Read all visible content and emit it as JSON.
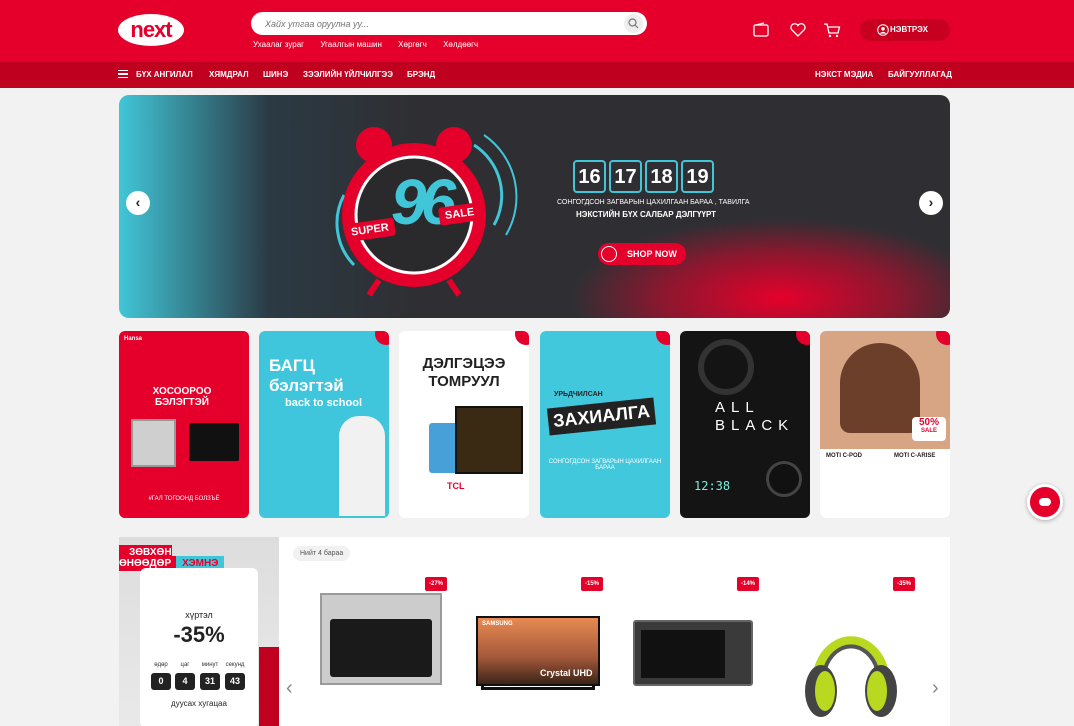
{
  "header": {
    "logo_text": "next",
    "search_placeholder": "Хайх утгаа оруулна уу...",
    "quick_links": [
      "Ухаалаг зураг",
      "Угаалгын машин",
      "Хөргөгч",
      "Хөлдөөгч"
    ],
    "login_label": "НЭВТРЭХ"
  },
  "nav": {
    "all_categories": "БҮХ АНГИЛАЛ",
    "items": [
      "ХЯМДРАЛ",
      "ШИНЭ",
      "ЗЭЭЛИЙН ҮЙЛЧИЛГЭЭ",
      "БРЭНД"
    ],
    "right_items": [
      "НЭКСТ МЭДИА",
      "БАЙГУУЛЛАГАД"
    ]
  },
  "hero": {
    "days": [
      "16",
      "17",
      "18",
      "19"
    ],
    "headline_super": "SUPER",
    "headline_number": "96",
    "headline_sale": "SALE",
    "line1": "СОНГОГДСОН ЗАГВАРЫН ЦАХИЛГААН БАРАА , ТАВИЛГА",
    "line2": "НЭКСТИЙН БҮХ САЛБАР ДЭЛГҮҮРТ",
    "cta": "SHOP NOW"
  },
  "promos": [
    {
      "brand": "Hansa",
      "title": "ХОСООРОО БЭЛЭГТЭЙ",
      "footer": "#ГАЛ ТОГООНД БОЛЗЪЁ"
    },
    {
      "title": "БАГЦ бэлэгтэй",
      "sub": "back to school"
    },
    {
      "title": "ДЭЛГЭЦЭЭ ТОМРУУЛ",
      "brand": "TCL"
    },
    {
      "title": "ЗАХИАЛГА",
      "pre": "УРЬДЧИЛСАН",
      "footer": "СОНГОГДСОН ЗАГВАРЫН ЦАХИЛГААН БАРАА"
    },
    {
      "title": "ALL BLACK",
      "time": "12:38"
    },
    {
      "badge": "50%",
      "badge_sub": "SALE",
      "items": [
        "MOTI C-POD",
        "MOTI C-ARISE"
      ]
    }
  ],
  "daily": {
    "banner_a": "ЗӨВХӨН ӨНӨӨДӨР",
    "banner_b": "ХЭМНЭ",
    "upto": "хүртэл",
    "percent": "-35%",
    "timer_labels": [
      "өдөр",
      "цаг",
      "минут",
      "секунд"
    ],
    "timer_values": [
      "0",
      "4",
      "31",
      "43"
    ],
    "remaining": "дуусах хугацаа",
    "count_label": "Нийт 4 бараа",
    "products": [
      {
        "discount": "-27%",
        "name": "oven"
      },
      {
        "discount": "-15%",
        "name": "tv",
        "brand": "SAMSUNG",
        "tv_text": "Crystal UHD"
      },
      {
        "discount": "-14%",
        "name": "microwave"
      },
      {
        "discount": "-35%",
        "name": "headphones"
      }
    ]
  }
}
